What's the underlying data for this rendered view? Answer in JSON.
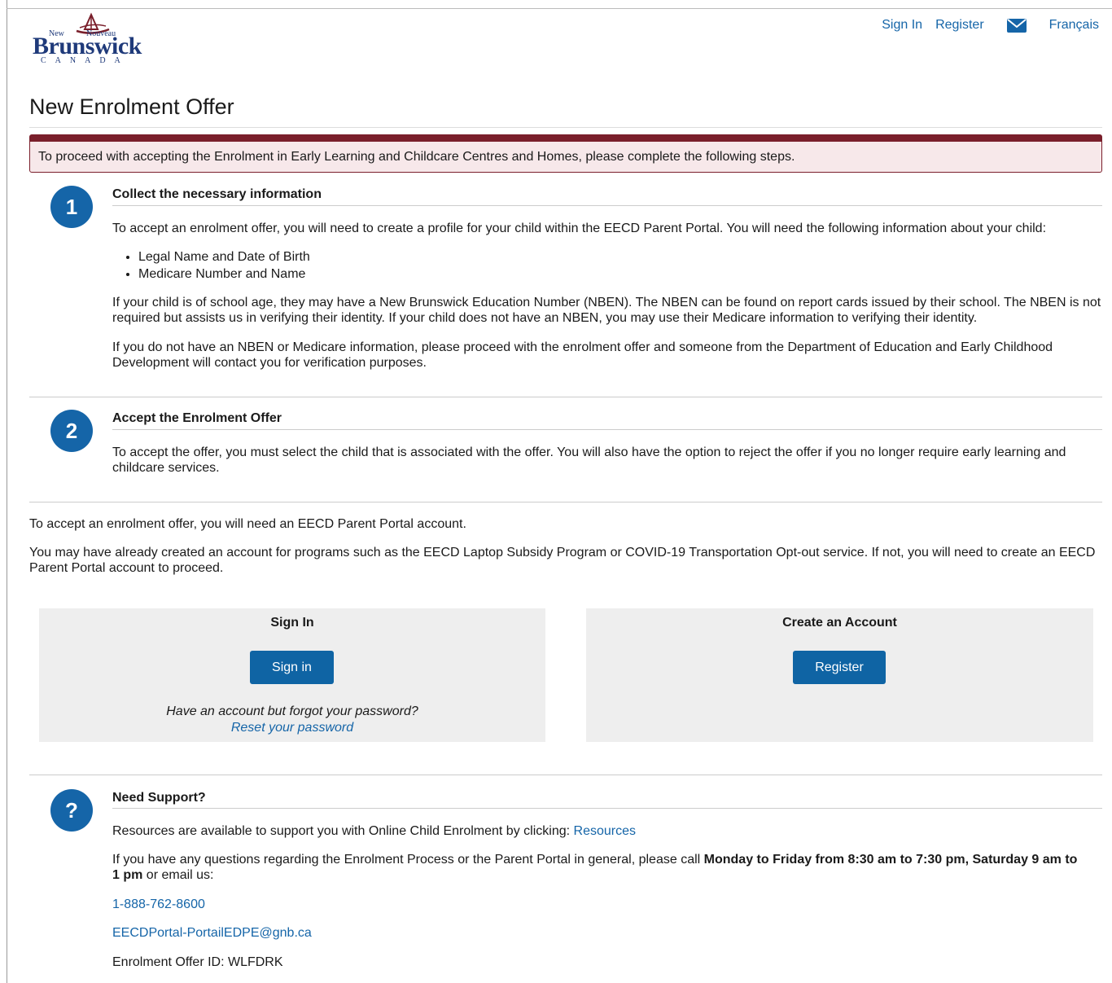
{
  "header": {
    "logo": {
      "new": "New",
      "nouveau": "Nouveau",
      "name": "Brunswick",
      "country": "CANADA"
    },
    "nav": {
      "sign_in": "Sign In",
      "register": "Register",
      "mail_icon": "envelope-icon",
      "language": "Français"
    }
  },
  "page": {
    "title": "New Enrolment Offer",
    "alert": "To proceed with accepting the Enrolment in Early Learning and Childcare Centres and Homes, please complete the following steps."
  },
  "steps": [
    {
      "number": "1",
      "title": "Collect the necessary information",
      "intro": "To accept an enrolment offer, you will need to create a profile for your child within the EECD Parent Portal. You will need the following information about your child:",
      "items": [
        "Legal Name and Date of Birth",
        "Medicare Number and Name"
      ],
      "para2": "If your child is of school age, they may have a New Brunswick Education Number (NBEN). The NBEN can be found on report cards issued by their school. The NBEN is not required but assists us in verifying their identity. If your child does not have an NBEN, you may use their Medicare information to verifying their identity.",
      "para3": "If you do not have an NBEN or Medicare information, please proceed with the enrolment offer and someone from the Department of Education and Early Childhood Development will contact you for verification purposes."
    },
    {
      "number": "2",
      "title": "Accept the Enrolment Offer",
      "text": "To accept the offer, you must select the child that is associated with the offer. You will also have the option to reject the offer if you no longer require early learning and childcare services."
    }
  ],
  "account": {
    "text1": "To accept an enrolment offer, you will need an EECD Parent Portal account.",
    "text2": "You may have already created an account for programs such as the EECD Laptop Subsidy Program or COVID-19 Transportation Opt-out service. If not, you will need to create an EECD Parent Portal account to proceed.",
    "sign_in_panel": {
      "title": "Sign In",
      "button": "Sign in",
      "forgot": "Have an account but forgot your password?",
      "reset": "Reset your password"
    },
    "create_panel": {
      "title": "Create an Account",
      "button": "Register"
    }
  },
  "support": {
    "badge": "?",
    "title": "Need Support?",
    "resources_text": "Resources are available to support you with Online Child Enrolment by clicking:",
    "resources_link": "Resources",
    "questions_pre": "If you have any questions regarding the Enrolment Process or the Parent Portal in general, please call",
    "hours_line1": "Monday to Friday from 8:30 am to 7:30 pm, Saturday 9 am to",
    "hours_line2": "1 pm",
    "questions_post": "or email us:",
    "phone": "1-888-762-8600",
    "email": "EECDPortal-PortailEDPE@gnb.ca",
    "offer_id": "Enrolment Offer ID: WLFDRK"
  },
  "colors": {
    "accent": "#1565a8",
    "alert": "#7a1f2b",
    "button": "#0f64a4"
  }
}
